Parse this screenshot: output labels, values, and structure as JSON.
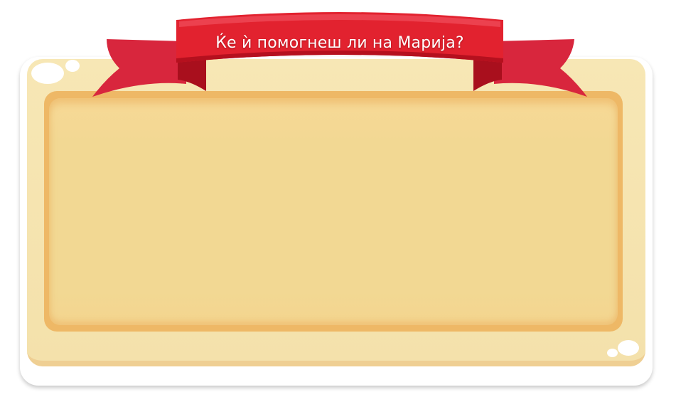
{
  "banner": {
    "title": "Ќе ѝ помогнеш ли на Марија?"
  },
  "colors": {
    "ribbon_main": "#e2222f",
    "ribbon_dark": "#b5101e",
    "ribbon_side": "#d8263d",
    "board_outer": "#f6e3ae",
    "board_frame": "#eeb866",
    "board_face": "#f2d893"
  }
}
